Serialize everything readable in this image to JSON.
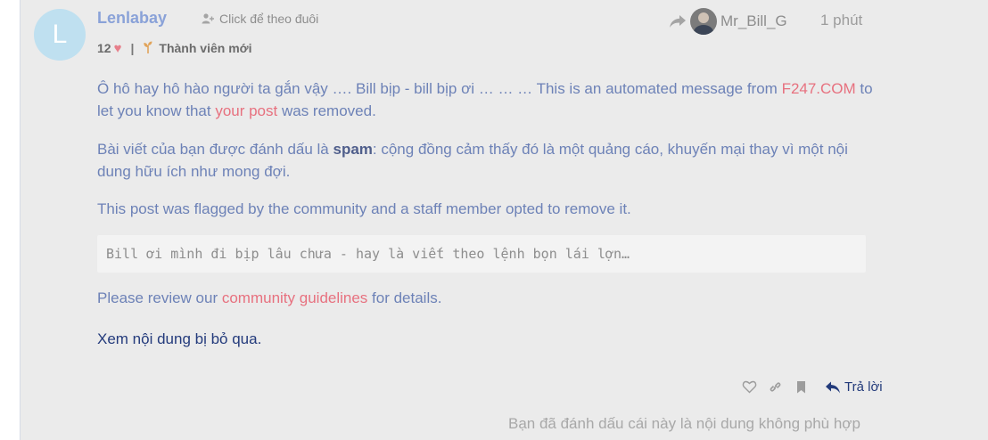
{
  "post": {
    "avatar_letter": "L",
    "username": "Lenlabay",
    "follow_label": "Click để theo đuôi",
    "likes": "12",
    "rank": "Thành viên mới",
    "reply_to_user": "Mr_Bill_G",
    "time": "1 phút"
  },
  "content": {
    "p1_a": "Ô hô hay hô hào người ta gắn vậy …. Bill bịp - bill bịp ơi … … … This is an automated message from ",
    "p1_link1": "F247.COM",
    "p1_b": " to let you know that ",
    "p1_link2": "your post",
    "p1_c": " was removed.",
    "p2_a": "Bài viết của bạn được đánh dấu là ",
    "p2_bold": "spam",
    "p2_b": ": cộng đồng cảm thấy đó là một quảng cáo, khuyến mại thay vì một nội dung hữu ích như mong đợi.",
    "p3": "This post was flagged by the community and a staff member opted to remove it.",
    "quote": "Bill ơi mình đi bịp lâu chưa - hay là viết theo lệnh bọn lái lợn…",
    "review_a": "Please review our ",
    "review_link": "community guidelines",
    "review_b": " for details.",
    "ignored_link": "Xem nội dung bị bỏ qua."
  },
  "actions": {
    "reply_label": "Trả lời",
    "icons": [
      "heart-outline-icon",
      "link-icon",
      "bookmark-icon",
      "reply-icon"
    ]
  },
  "footer": {
    "flag_note": "Bạn đã đánh dấu cái này là nội dung không phù hợp"
  },
  "colors": {
    "background": "#ebebeb",
    "text_blue": "#6d82b7",
    "link_red": "#e7717f",
    "dark_blue": "#223a7a",
    "username": "#8aa2d8"
  }
}
